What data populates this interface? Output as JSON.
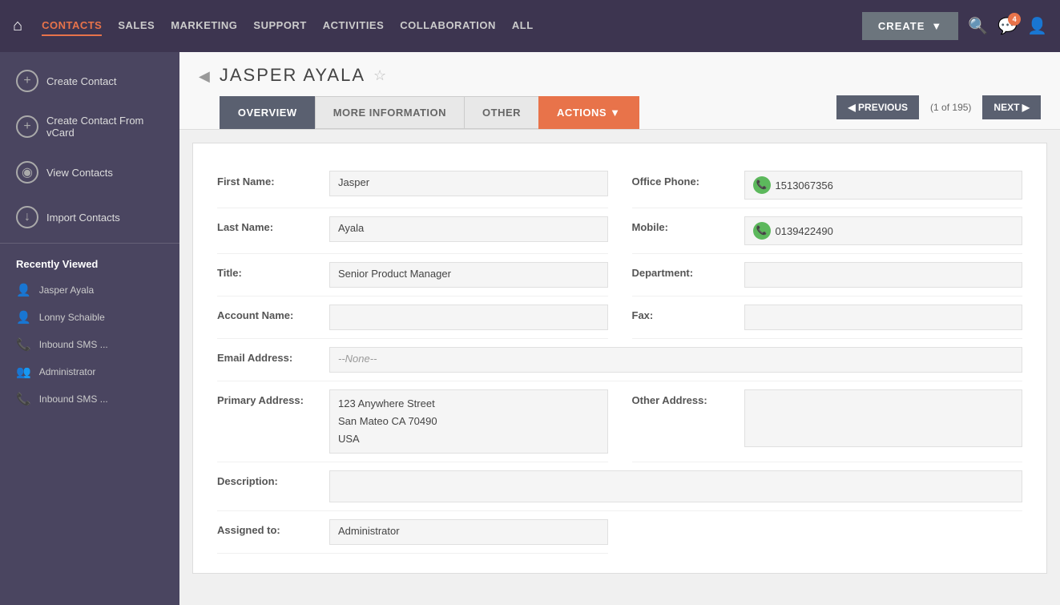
{
  "topnav": {
    "home_icon": "⌂",
    "items": [
      {
        "label": "CONTACTS",
        "active": true
      },
      {
        "label": "SALES",
        "active": false
      },
      {
        "label": "MARKETING",
        "active": false
      },
      {
        "label": "SUPPORT",
        "active": false
      },
      {
        "label": "ACTIVITIES",
        "active": false
      },
      {
        "label": "COLLABORATION",
        "active": false
      },
      {
        "label": "ALL",
        "active": false
      }
    ],
    "create_label": "CREATE",
    "create_dropdown": "▼",
    "notif_count": "4"
  },
  "sidebar": {
    "actions": [
      {
        "label": "Create Contact",
        "icon": "+"
      },
      {
        "label": "Create Contact From vCard",
        "icon": "+"
      },
      {
        "label": "View Contacts",
        "icon": "◉"
      },
      {
        "label": "Import Contacts",
        "icon": "↓"
      }
    ],
    "recently_viewed_label": "Recently Viewed",
    "recent_items": [
      {
        "label": "Jasper Ayala",
        "icon": "person"
      },
      {
        "label": "Lonny Schaible",
        "icon": "person"
      },
      {
        "label": "Inbound SMS ...",
        "icon": "phone"
      },
      {
        "label": "Administrator",
        "icon": "people"
      },
      {
        "label": "Inbound SMS ...",
        "icon": "phone"
      }
    ]
  },
  "record": {
    "back_arrow": "◀",
    "name": "JASPER AYALA",
    "star": "☆",
    "tabs": [
      {
        "label": "OVERVIEW",
        "active": true
      },
      {
        "label": "MORE INFORMATION",
        "active": false
      },
      {
        "label": "OTHER",
        "active": false
      },
      {
        "label": "ACTIONS ▼",
        "active": false,
        "actions": true
      }
    ],
    "pagination": {
      "prev_label": "◀ PREVIOUS",
      "page_info": "(1 of 195)",
      "next_label": "NEXT ▶"
    },
    "fields": {
      "first_name_label": "First Name:",
      "first_name_value": "Jasper",
      "last_name_label": "Last Name:",
      "last_name_value": "Ayala",
      "title_label": "Title:",
      "title_value": "Senior Product Manager",
      "account_name_label": "Account Name:",
      "account_name_value": "",
      "email_label": "Email Address:",
      "email_value": "--None--",
      "primary_address_label": "Primary Address:",
      "primary_address_line1": "123 Anywhere Street",
      "primary_address_line2": "San Mateo CA  70490",
      "primary_address_line3": "USA",
      "description_label": "Description:",
      "description_value": "",
      "assigned_to_label": "Assigned to:",
      "assigned_to_value": "Administrator",
      "office_phone_label": "Office Phone:",
      "office_phone_value": "1513067356",
      "mobile_label": "Mobile:",
      "mobile_value": "0139422490",
      "department_label": "Department:",
      "department_value": "",
      "fax_label": "Fax:",
      "fax_value": "",
      "other_address_label": "Other Address:",
      "other_address_value": ""
    }
  }
}
